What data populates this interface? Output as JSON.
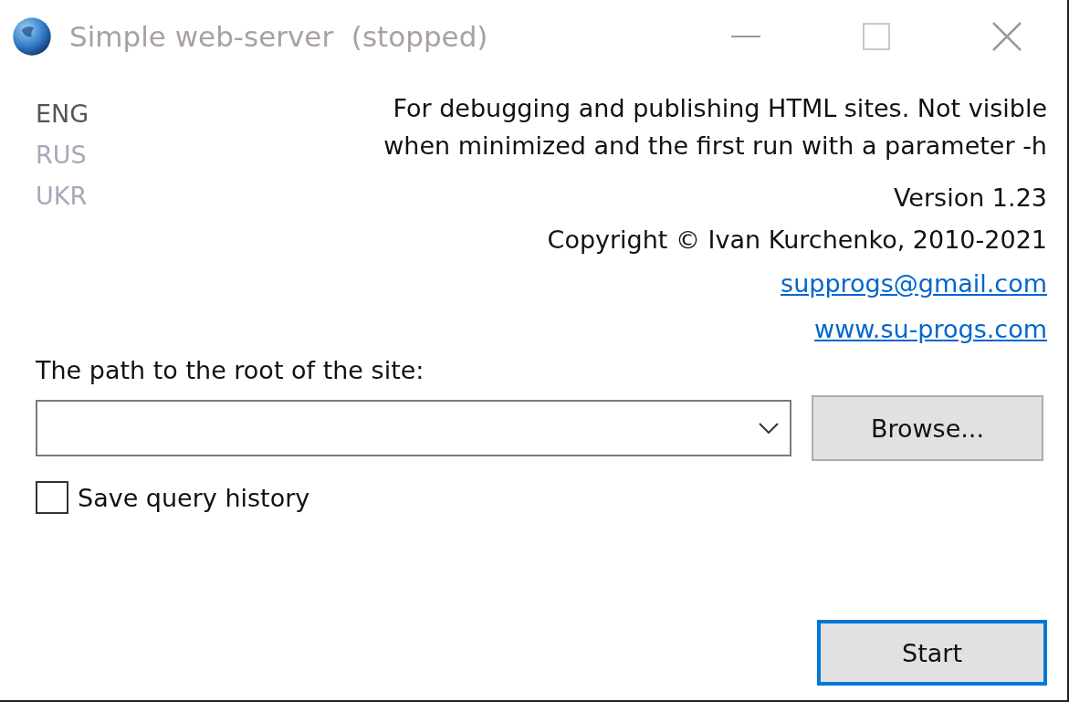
{
  "window": {
    "title": "Simple web-server  (stopped)"
  },
  "languages": [
    {
      "label": "ENG",
      "selected": true
    },
    {
      "label": "RUS",
      "selected": false
    },
    {
      "label": "UKR",
      "selected": false
    }
  ],
  "description": "For debugging and publishing HTML sites. Not visible when minimized and the first run with a parameter -h",
  "version": "Version 1.23",
  "copyright": "Copyright © Ivan Kurchenko, 2010-2021",
  "email_link": "supprogs@gmail.com",
  "website_link": "www.su-progs.com",
  "path_label": "The path to the root of the site:",
  "browse_button": "Browse...",
  "save_history": {
    "label": "Save query history",
    "checked": false
  },
  "start_button": "Start"
}
